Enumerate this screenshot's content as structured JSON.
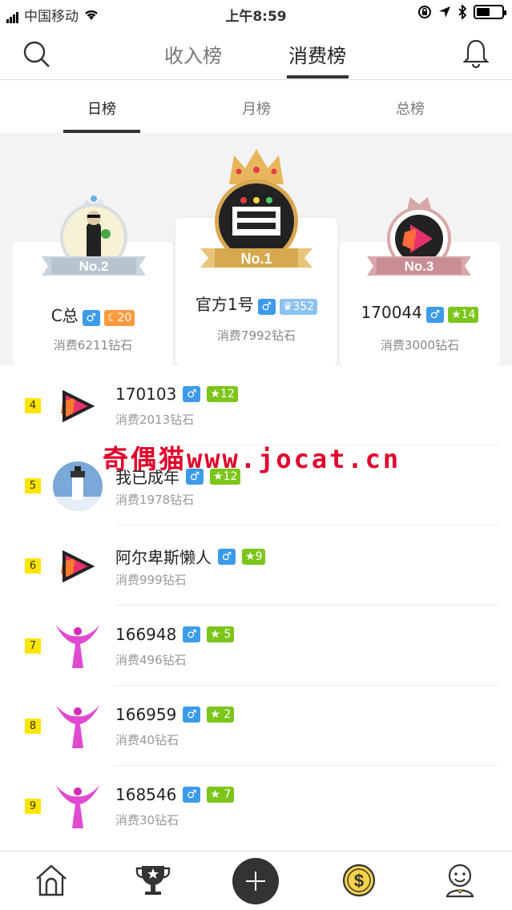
{
  "status": {
    "carrier": "中国移动",
    "time": "上午8:59"
  },
  "nav": {
    "tabs": [
      "收入榜",
      "消费榜"
    ],
    "active": 1
  },
  "subtabs": {
    "items": [
      "日榜",
      "月榜",
      "总榜"
    ],
    "active": 0
  },
  "podium": [
    {
      "rank": "No.2",
      "name": "C总",
      "gender": "♂",
      "level": "20",
      "level_color": "#ff9a3c",
      "spent": "消费6211钻石"
    },
    {
      "rank": "No.1",
      "name": "官方1号",
      "gender": "♂",
      "level": "352",
      "level_color": "#8cc2f2",
      "spent": "消费7992钻石"
    },
    {
      "rank": "No.3",
      "name": "170044",
      "gender": "♂",
      "level": "14",
      "level_color": "#7cc51a",
      "spent": "消费3000钻石"
    }
  ],
  "list": [
    {
      "rank": "4",
      "name": "170103",
      "gender": "♂",
      "level": "12",
      "spent": "消费2013钻石"
    },
    {
      "rank": "5",
      "name": "我已成年",
      "gender": "♂",
      "level": "12",
      "spent": "消费1978钻石"
    },
    {
      "rank": "6",
      "name": "阿尔卑斯懒人",
      "gender": "♂",
      "level": "9",
      "spent": "消费999钻石"
    },
    {
      "rank": "7",
      "name": "166948",
      "gender": "♂",
      "level": "5",
      "spent": "消费496钻石"
    },
    {
      "rank": "8",
      "name": "166959",
      "gender": "♂",
      "level": "2",
      "spent": "消费40钻石"
    },
    {
      "rank": "9",
      "name": "168546",
      "gender": "♂",
      "level": "7",
      "spent": "消费30钻石"
    }
  ],
  "watermark": "奇偶猫www.jocat.cn",
  "colors": {
    "accent": "#333333",
    "gender": "#3d9be9",
    "level": "#7cc51a",
    "rank_badge": "#ffe400"
  }
}
